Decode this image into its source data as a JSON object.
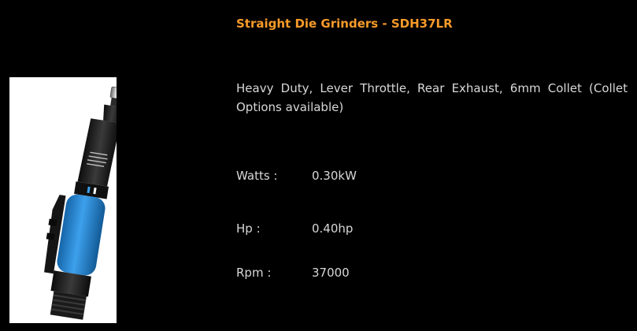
{
  "product": {
    "title": "Straight Die Grinders - SDH37LR",
    "description": "Heavy Duty, Lever Throttle, Rear Exhaust, 6mm Collet (Collet Options available)",
    "image_label": "die-grinder-photo"
  },
  "specs": {
    "watts": {
      "label": "Watts :",
      "value": "0.30kW"
    },
    "hp": {
      "label": "Hp :",
      "value": "0.40hp"
    },
    "rpm": {
      "label": "Rpm :",
      "value": "37000"
    }
  },
  "colors": {
    "background": "#000000",
    "title": "#f79a2a",
    "text": "#d8d8d8",
    "grip_blue": "#2f8fd8"
  }
}
